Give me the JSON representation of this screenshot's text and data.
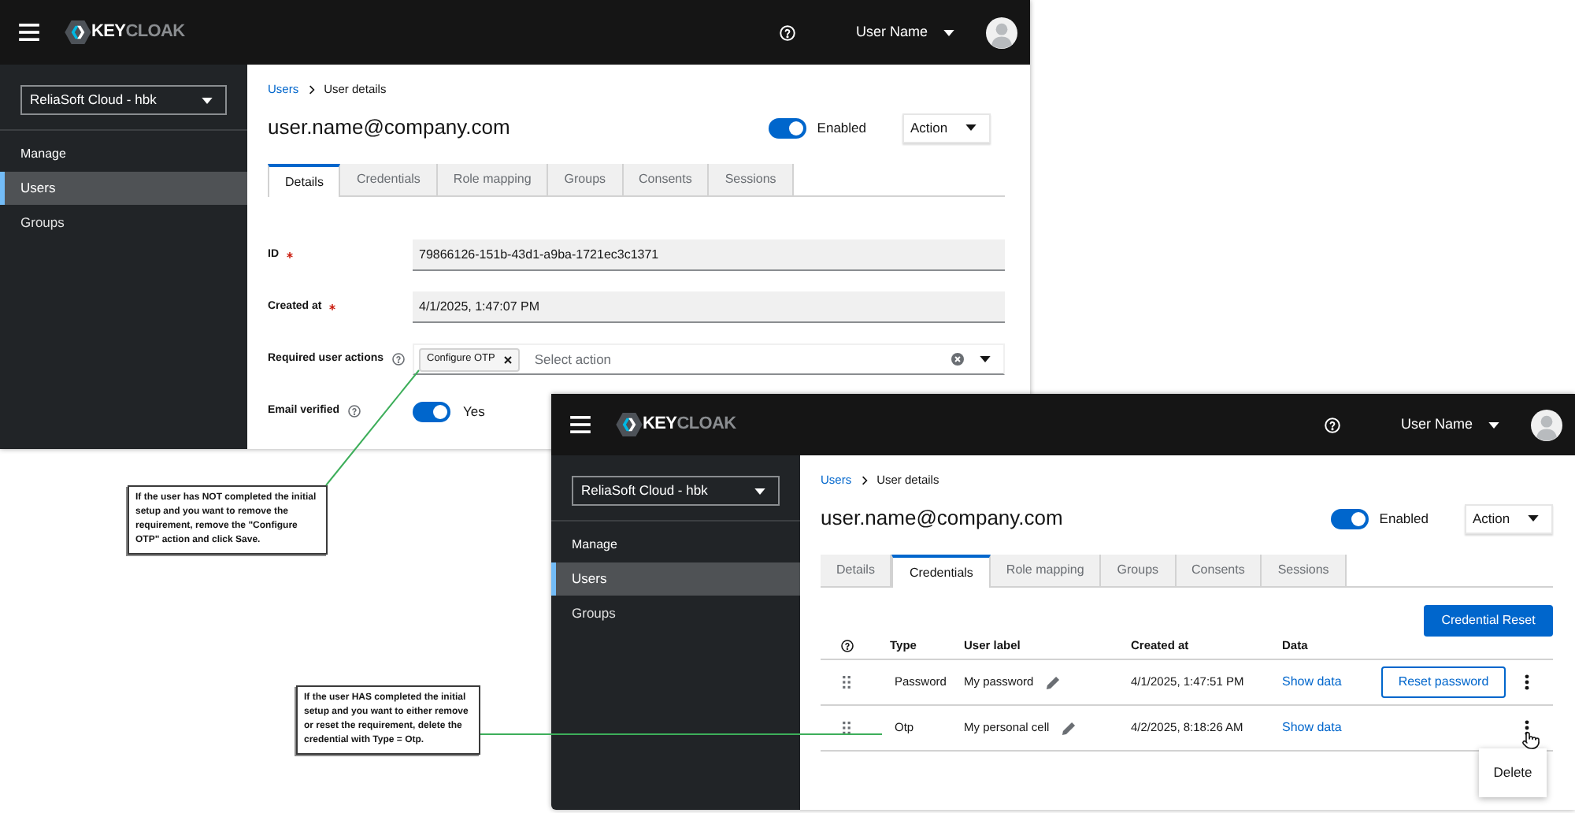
{
  "screenshots": [
    {
      "kind": "details",
      "logo": [
        {
          "text": "KEY",
          "kind": "bright"
        },
        {
          "text": "CLOAK",
          "kind": "dim"
        }
      ],
      "user_menu": "User Name",
      "realm": "ReliaSoft Cloud - hbk",
      "nav_section": "Manage",
      "nav_items": [
        {
          "label": "Users",
          "selected": true
        },
        {
          "label": "Groups",
          "selected": false
        }
      ],
      "breadcrumb": [
        {
          "label": "Users",
          "kind": "link"
        },
        {
          "label": "User details",
          "kind": "current"
        }
      ],
      "title": "user.name@company.com",
      "enabled": {
        "label": "Enabled",
        "on": true
      },
      "action_menu": "Action",
      "tabs": [
        {
          "label": "Details",
          "selected": true
        },
        {
          "label": "Credentials",
          "selected": false
        },
        {
          "label": "Role mapping",
          "selected": false
        },
        {
          "label": "Groups",
          "selected": false
        },
        {
          "label": "Consents",
          "selected": false
        },
        {
          "label": "Sessions",
          "selected": false
        }
      ],
      "form": [
        {
          "kind": "readonly",
          "label": "ID",
          "required": true,
          "help": false,
          "value": "79866126-151b-43d1-a9ba-1721ec3c1371"
        },
        {
          "kind": "readonly",
          "label": "Created at",
          "required": true,
          "help": false,
          "value": "4/1/2025, 1:47:07 PM"
        },
        {
          "kind": "chips",
          "label": "Required user actions",
          "required": false,
          "help": true,
          "chips": [
            "Configure OTP"
          ],
          "placeholder": "Select action"
        },
        {
          "kind": "switch",
          "label": "Email verified",
          "required": false,
          "help": true,
          "on": true,
          "value": "Yes"
        }
      ]
    },
    {
      "kind": "credentials",
      "logo": [
        {
          "text": "KEY",
          "kind": "bright"
        },
        {
          "text": "CLOAK",
          "kind": "dim"
        }
      ],
      "user_menu": "User Name",
      "realm": "ReliaSoft Cloud - hbk",
      "nav_section": "Manage",
      "nav_items": [
        {
          "label": "Users",
          "selected": true
        },
        {
          "label": "Groups",
          "selected": false
        }
      ],
      "breadcrumb": [
        {
          "label": "Users",
          "kind": "link"
        },
        {
          "label": "User details",
          "kind": "current"
        }
      ],
      "title": "user.name@company.com",
      "enabled": {
        "label": "Enabled",
        "on": true
      },
      "action_menu": "Action",
      "tabs": [
        {
          "label": "Details",
          "selected": false
        },
        {
          "label": "Credentials",
          "selected": true
        },
        {
          "label": "Role mapping",
          "selected": false
        },
        {
          "label": "Groups",
          "selected": false
        },
        {
          "label": "Consents",
          "selected": false
        },
        {
          "label": "Sessions",
          "selected": false
        }
      ],
      "credentials": {
        "reset_button": "Credential Reset",
        "columns": [
          "Type",
          "User label",
          "Created at",
          "Data"
        ],
        "rows": [
          {
            "type": "Password",
            "user_label": "My password",
            "created_at": "4/1/2025, 1:47:51 PM",
            "data_link": "Show data",
            "action": "Reset password",
            "menu": {
              "open": false
            }
          },
          {
            "type": "Otp",
            "user_label": "My personal cell",
            "created_at": "4/2/2025, 8:18:26 AM",
            "data_link": "Show data",
            "menu": {
              "open": true,
              "items": [
                "Delete"
              ]
            }
          }
        ]
      }
    }
  ],
  "annotations": [
    {
      "text": "If the user has NOT completed the initial setup and you want to remove the requirement, remove the \"Configure OTP\" action and click Save."
    },
    {
      "text": "If the user HAS completed the initial setup and you want to either remove or reset the requirement, delete the credential with Type = Otp."
    }
  ]
}
